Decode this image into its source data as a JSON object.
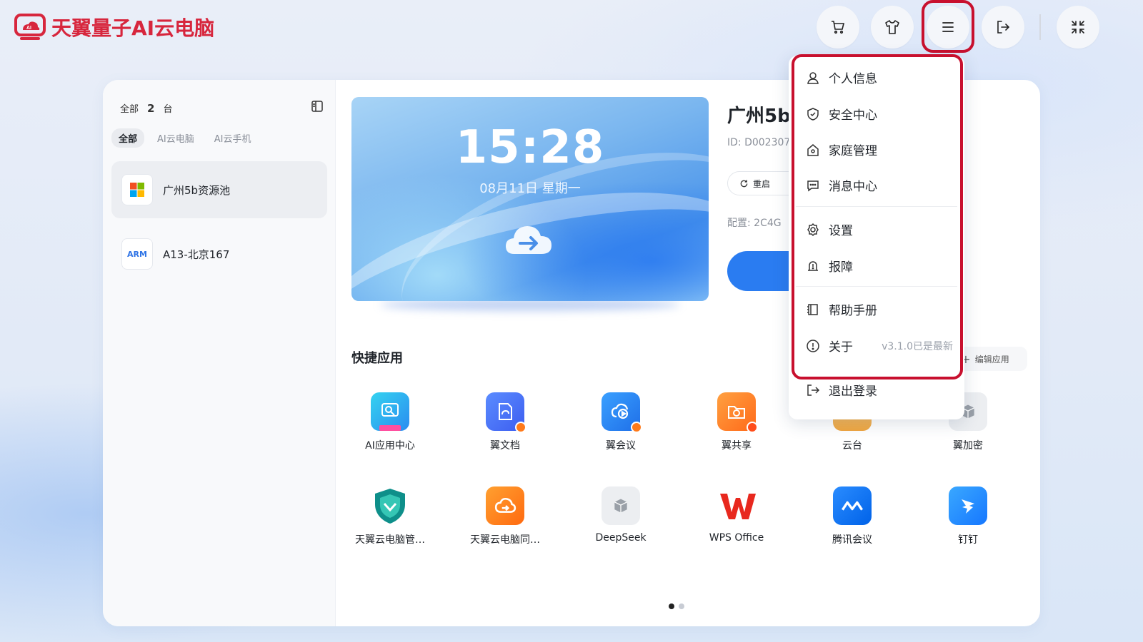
{
  "app": {
    "title": "天翼量子AI云电脑"
  },
  "topbar": {
    "icons": [
      "cart-icon",
      "tshirt-icon",
      "menu-icon",
      "logout-icon",
      "collapse-icon"
    ]
  },
  "sidebar": {
    "all_label": "全部",
    "count": "2",
    "unit": "台",
    "filters": [
      "全部",
      "AI云电脑",
      "AI云手机"
    ],
    "devices": [
      {
        "name": "广州5b资源池",
        "icon": "windows-icon"
      },
      {
        "name": "A13-北京167",
        "icon": "arm-icon",
        "badge": "ARM"
      }
    ]
  },
  "preview": {
    "time": "15:28",
    "date": "08月11日  星期一"
  },
  "device_detail": {
    "title": "广州5b",
    "id": "ID: D002307",
    "restart_label": "重启",
    "config": "配置: 2C4G"
  },
  "quick_apps": {
    "title": "快捷应用",
    "edit_label": "编辑应用",
    "apps": [
      {
        "label": "AI应用中心"
      },
      {
        "label": "翼文档"
      },
      {
        "label": "翼会议"
      },
      {
        "label": "翼共享"
      },
      {
        "label": "云台"
      },
      {
        "label": "翼加密"
      },
      {
        "label": "天翼云电脑管…"
      },
      {
        "label": "天翼云电脑同…"
      },
      {
        "label": "DeepSeek"
      },
      {
        "label": "WPS Office"
      },
      {
        "label": "腾讯会议"
      },
      {
        "label": "钉钉"
      }
    ]
  },
  "menu": {
    "items": [
      {
        "label": "个人信息",
        "icon": "user-icon"
      },
      {
        "label": "安全中心",
        "icon": "shield-icon"
      },
      {
        "label": "家庭管理",
        "icon": "home-icon"
      },
      {
        "label": "消息中心",
        "icon": "message-icon"
      },
      {
        "label": "设置",
        "icon": "gear-icon"
      },
      {
        "label": "报障",
        "icon": "report-icon"
      },
      {
        "label": "帮助手册",
        "icon": "book-icon"
      },
      {
        "label": "关于",
        "icon": "info-icon",
        "note": "v3.1.0已是最新"
      },
      {
        "label": "退出登录",
        "icon": "logout-icon"
      }
    ]
  },
  "colors": {
    "brand": "#d7263d",
    "highlight": "#c8102e",
    "accent": "#2a7cf1"
  }
}
